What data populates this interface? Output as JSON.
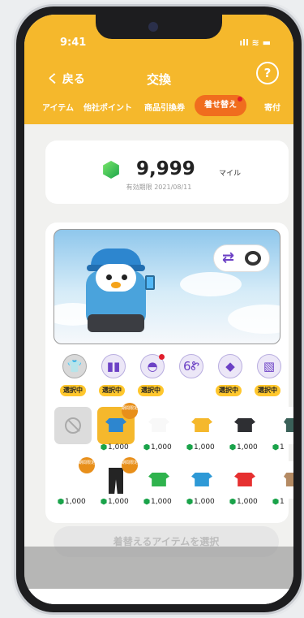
{
  "status": {
    "time": "9:41",
    "icons": "ıll ≋ ▬"
  },
  "header": {
    "back_label": "く 戻る",
    "title": "交換",
    "help_label": "?"
  },
  "tabs": [
    {
      "label": "アイテム"
    },
    {
      "label": "他社ポイント"
    },
    {
      "label": "商品引換券"
    },
    {
      "label": "着せ替え",
      "active": true
    },
    {
      "label": "寄付"
    }
  ],
  "balance": {
    "amount": "9,999",
    "unit": "マイル",
    "expiry": "有効期限 2021/08/11"
  },
  "preview": {
    "swap_icon": "⇄",
    "character": "penguin-wearing-blue-cap-and-hoodie"
  },
  "categories": [
    {
      "icon": "shirt-icon",
      "glyph": "👕",
      "status": "選択中"
    },
    {
      "icon": "pants-icon",
      "glyph": "▮▮",
      "status": "選択中"
    },
    {
      "icon": "hat-icon",
      "glyph": "◓",
      "status": "選択中",
      "has_dot": true
    },
    {
      "icon": "glasses-icon",
      "glyph": "6Ꮡ",
      "status": ""
    },
    {
      "icon": "bag-icon",
      "glyph": "◆",
      "status": "選択中"
    },
    {
      "icon": "background-icon",
      "glyph": "▧",
      "status": "選択中"
    }
  ],
  "items": [
    [
      {
        "type": "none",
        "price": ""
      },
      {
        "type": "shirt",
        "color": "#2d86cf",
        "price": "1,000",
        "limited": true,
        "limited_text": "期間限定",
        "selected": true
      },
      {
        "type": "shirt",
        "color": "#f8f8f8",
        "price": "1,000"
      },
      {
        "type": "shirt",
        "color": "#f5b82c",
        "price": "1,000"
      },
      {
        "type": "shirt",
        "color": "#2e2f33",
        "price": "1,000"
      },
      {
        "type": "coat",
        "color": "#3a6058",
        "price": "1"
      }
    ],
    [
      {
        "type": "shirt",
        "color": "#ffffff",
        "price": "1,000",
        "limited": true,
        "limited_text": "期間限定"
      },
      {
        "type": "pants",
        "color": "#242424",
        "price": "1,000",
        "limited": true,
        "limited_text": "期間限定"
      },
      {
        "type": "shirt",
        "color": "#2fb34d",
        "price": "1,000"
      },
      {
        "type": "shirt",
        "color": "#2e99d6",
        "price": "1,000"
      },
      {
        "type": "shirt",
        "color": "#e63030",
        "price": "1,000"
      },
      {
        "type": "coat",
        "color": "#b48a63",
        "price": "1"
      }
    ]
  ],
  "cta": {
    "label": "着替えるアイテムを選択"
  }
}
